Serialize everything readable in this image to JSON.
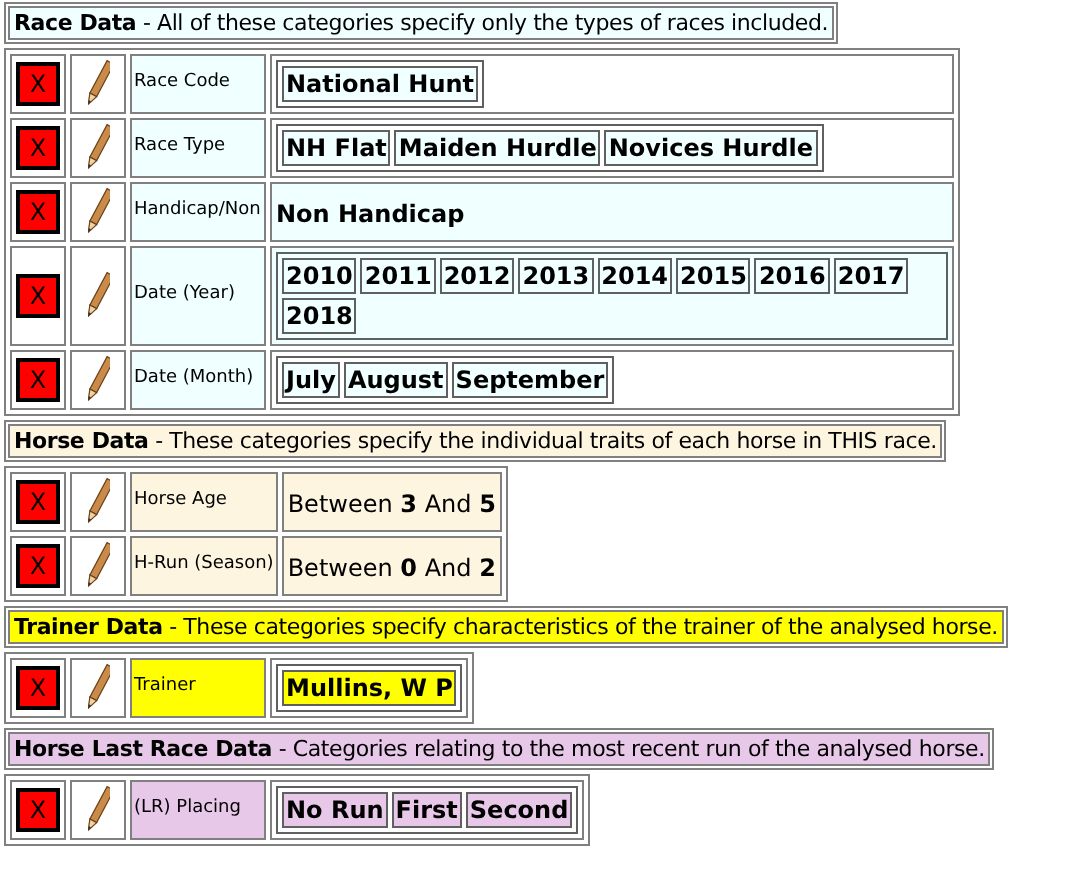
{
  "sections": [
    {
      "title": "Race Data",
      "description": "- All of these categories specify only the types of races included.",
      "color": "#f0ffff",
      "rows": [
        {
          "delete": "X",
          "label": "Race Code",
          "shaded": false,
          "kind": "tags",
          "tags": [
            "National Hunt"
          ]
        },
        {
          "delete": "X",
          "label": "Race Type",
          "shaded": false,
          "kind": "tags",
          "tags": [
            "NH Flat",
            "Maiden Hurdle",
            "Novices Hurdle"
          ]
        },
        {
          "delete": "X",
          "label": "Handicap/Non",
          "shaded": true,
          "kind": "text",
          "text": "**Non Handicap**"
        },
        {
          "delete": "X",
          "label": "Date (Year)",
          "shaded": true,
          "kind": "tags",
          "tags": [
            "2010",
            "2011",
            "2012",
            "2013",
            "2014",
            "2015",
            "2016",
            "2017",
            "2018"
          ]
        },
        {
          "delete": "X",
          "label": "Date (Month)",
          "shaded": false,
          "kind": "tags",
          "tags": [
            "July",
            "August",
            "September"
          ]
        }
      ]
    },
    {
      "title": "Horse Data",
      "description": "- These categories specify the individual traits of each horse in THIS race.",
      "color": "#fdf5e0",
      "rows": [
        {
          "delete": "X",
          "label": "Horse Age",
          "shaded": true,
          "kind": "text",
          "text": "Between **3** And **5**"
        },
        {
          "delete": "X",
          "label": "H-Run (Season)",
          "shaded": true,
          "kind": "text",
          "text": "Between **0** And **2**"
        }
      ]
    },
    {
      "title": "Trainer Data",
      "description": "- These categories specify characteristics of the trainer of the analysed horse.",
      "color": "#ffff00",
      "rows": [
        {
          "delete": "X",
          "label": "Trainer",
          "shaded": false,
          "kind": "tags",
          "tags": [
            "Mullins, W P"
          ]
        }
      ]
    },
    {
      "title": "Horse Last Race Data",
      "description": "- Categories relating to the most recent run of the analysed horse.",
      "color": "#e8c8e8",
      "rows": [
        {
          "delete": "X",
          "label": "(LR) Placing",
          "shaded": false,
          "kind": "tags",
          "tags": [
            "No Run",
            "First",
            "Second"
          ]
        }
      ]
    }
  ]
}
